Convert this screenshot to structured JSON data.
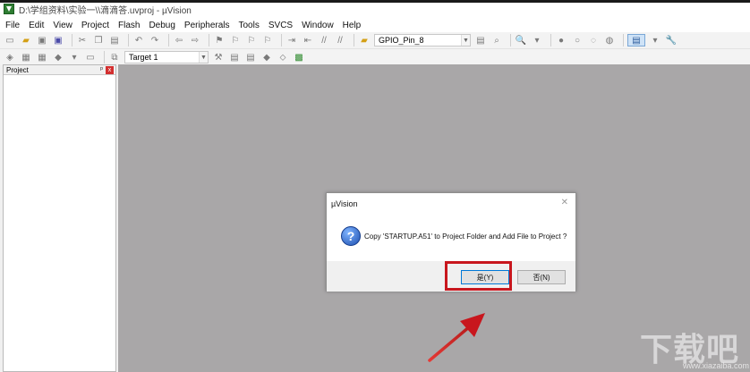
{
  "window": {
    "title": "D:\\学组资料\\实验一\\\\滴滴答.uvproj - µVision"
  },
  "menu": [
    "File",
    "Edit",
    "View",
    "Project",
    "Flash",
    "Debug",
    "Peripherals",
    "Tools",
    "SVCS",
    "Window",
    "Help"
  ],
  "toolbar": {
    "find_combo_value": "GPIO_Pin_8",
    "target_combo_value": "Target 1"
  },
  "project_panel": {
    "title": "Project",
    "pin_glyph": "ᵖ",
    "close_glyph": "x"
  },
  "dialog": {
    "title": "µVision",
    "close_glyph": "✕",
    "icon_glyph": "?",
    "message": "Copy 'STARTUP.A51' to Project Folder and Add File to Project ?",
    "yes_label": "是(Y)",
    "no_label": "否(N)"
  },
  "watermark": {
    "text": "下载吧",
    "url": "www.xiazaiba.com"
  },
  "colors": {
    "workspace_bg": "#a9a7a8",
    "highlight": "#c8161d",
    "annotation_arrow": "#c8161d"
  }
}
